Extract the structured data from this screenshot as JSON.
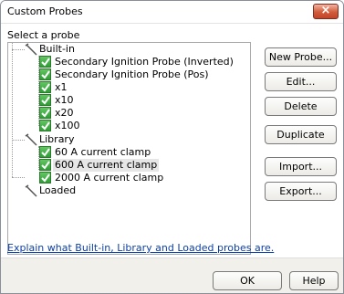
{
  "window": {
    "title": "Custom Probes",
    "close_label": "×"
  },
  "select_label": "Select a probe",
  "tree": {
    "groups": [
      {
        "label": "Built-in",
        "items": [
          "Secondary Ignition Probe (Inverted)",
          "Secondary Ignition Probe (Pos)",
          "x1",
          "x10",
          "x20",
          "x100"
        ]
      },
      {
        "label": "Library",
        "items": [
          "60 A current clamp",
          "600 A current clamp",
          "2000 A current clamp"
        ]
      },
      {
        "label": "Loaded",
        "items": []
      }
    ],
    "selected_item": "600 A current clamp"
  },
  "buttons": {
    "new_probe": "New Probe...",
    "edit": "Edit...",
    "delete": "Delete",
    "duplicate": "Duplicate",
    "import": "Import...",
    "export": "Export..."
  },
  "help_link": "Explain what Built-in, Library and Loaded probes are.",
  "footer": {
    "ok": "OK",
    "help": "Help"
  },
  "colors": {
    "link": "#0b3fa8",
    "check_green": "#2f9e36",
    "close_red": "#c2442a"
  }
}
